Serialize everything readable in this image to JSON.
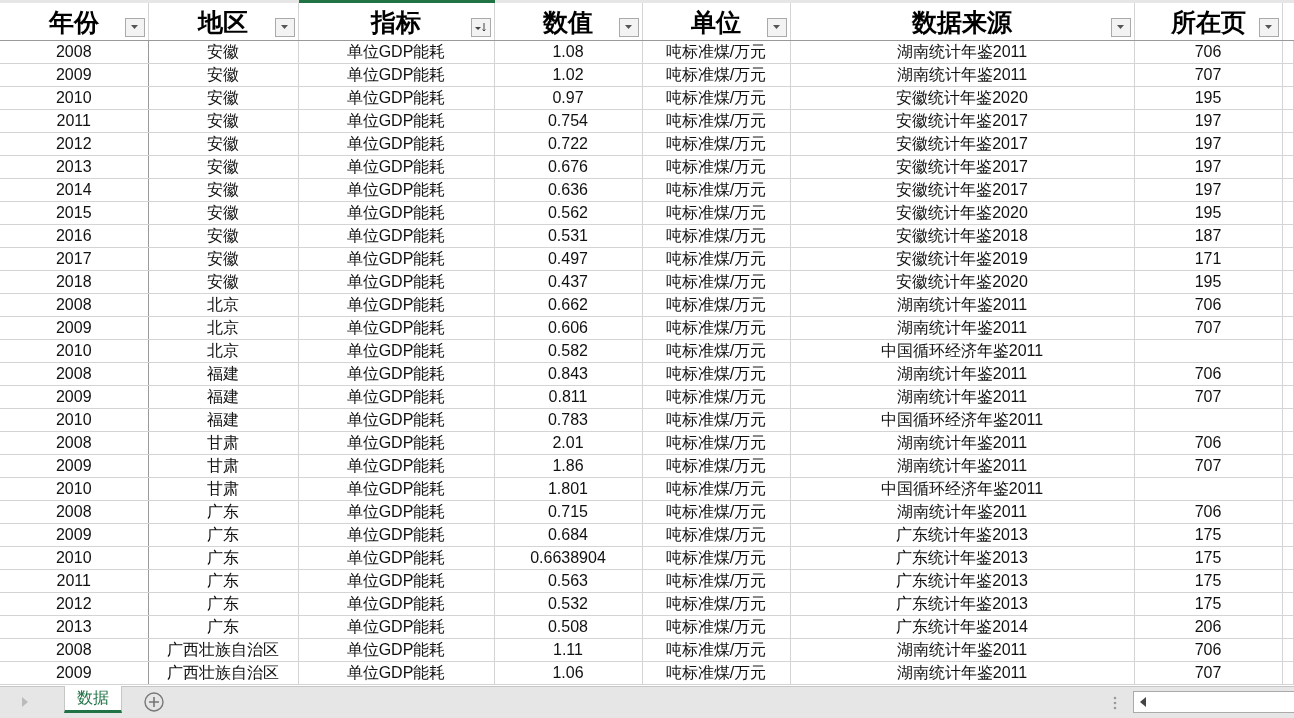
{
  "columns": [
    {
      "label": "年份",
      "sorted": false,
      "selected": false
    },
    {
      "label": "地区",
      "sorted": false,
      "selected": false
    },
    {
      "label": "指标",
      "sorted": true,
      "selected": true
    },
    {
      "label": "数值",
      "sorted": false,
      "selected": false
    },
    {
      "label": "单位",
      "sorted": false,
      "selected": false
    },
    {
      "label": "数据来源",
      "sorted": false,
      "selected": false
    },
    {
      "label": "所在页",
      "sorted": false,
      "selected": false
    }
  ],
  "rows": [
    {
      "year": "2008",
      "region": "安徽",
      "indicator": "单位GDP能耗",
      "value": "1.08",
      "unit": "吨标准煤/万元",
      "source": "湖南统计年鉴2011",
      "page": "706"
    },
    {
      "year": "2009",
      "region": "安徽",
      "indicator": "单位GDP能耗",
      "value": "1.02",
      "unit": "吨标准煤/万元",
      "source": "湖南统计年鉴2011",
      "page": "707"
    },
    {
      "year": "2010",
      "region": "安徽",
      "indicator": "单位GDP能耗",
      "value": "0.97",
      "unit": "吨标准煤/万元",
      "source": "安徽统计年鉴2020",
      "page": "195"
    },
    {
      "year": "2011",
      "region": "安徽",
      "indicator": "单位GDP能耗",
      "value": "0.754",
      "unit": "吨标准煤/万元",
      "source": "安徽统计年鉴2017",
      "page": "197"
    },
    {
      "year": "2012",
      "region": "安徽",
      "indicator": "单位GDP能耗",
      "value": "0.722",
      "unit": "吨标准煤/万元",
      "source": "安徽统计年鉴2017",
      "page": "197"
    },
    {
      "year": "2013",
      "region": "安徽",
      "indicator": "单位GDP能耗",
      "value": "0.676",
      "unit": "吨标准煤/万元",
      "source": "安徽统计年鉴2017",
      "page": "197"
    },
    {
      "year": "2014",
      "region": "安徽",
      "indicator": "单位GDP能耗",
      "value": "0.636",
      "unit": "吨标准煤/万元",
      "source": "安徽统计年鉴2017",
      "page": "197"
    },
    {
      "year": "2015",
      "region": "安徽",
      "indicator": "单位GDP能耗",
      "value": "0.562",
      "unit": "吨标准煤/万元",
      "source": "安徽统计年鉴2020",
      "page": "195"
    },
    {
      "year": "2016",
      "region": "安徽",
      "indicator": "单位GDP能耗",
      "value": "0.531",
      "unit": "吨标准煤/万元",
      "source": "安徽统计年鉴2018",
      "page": "187"
    },
    {
      "year": "2017",
      "region": "安徽",
      "indicator": "单位GDP能耗",
      "value": "0.497",
      "unit": "吨标准煤/万元",
      "source": "安徽统计年鉴2019",
      "page": "171"
    },
    {
      "year": "2018",
      "region": "安徽",
      "indicator": "单位GDP能耗",
      "value": "0.437",
      "unit": "吨标准煤/万元",
      "source": "安徽统计年鉴2020",
      "page": "195"
    },
    {
      "year": "2008",
      "region": "北京",
      "indicator": "单位GDP能耗",
      "value": "0.662",
      "unit": "吨标准煤/万元",
      "source": "湖南统计年鉴2011",
      "page": "706"
    },
    {
      "year": "2009",
      "region": "北京",
      "indicator": "单位GDP能耗",
      "value": "0.606",
      "unit": "吨标准煤/万元",
      "source": "湖南统计年鉴2011",
      "page": "707"
    },
    {
      "year": "2010",
      "region": "北京",
      "indicator": "单位GDP能耗",
      "value": "0.582",
      "unit": "吨标准煤/万元",
      "source": "中国循环经济年鉴2011"
    },
    {
      "year": "2008",
      "region": "福建",
      "indicator": "单位GDP能耗",
      "value": "0.843",
      "unit": "吨标准煤/万元",
      "source": "湖南统计年鉴2011",
      "page": "706"
    },
    {
      "year": "2009",
      "region": "福建",
      "indicator": "单位GDP能耗",
      "value": "0.811",
      "unit": "吨标准煤/万元",
      "source": "湖南统计年鉴2011",
      "page": "707"
    },
    {
      "year": "2010",
      "region": "福建",
      "indicator": "单位GDP能耗",
      "value": "0.783",
      "unit": "吨标准煤/万元",
      "source": "中国循环经济年鉴2011"
    },
    {
      "year": "2008",
      "region": "甘肃",
      "indicator": "单位GDP能耗",
      "value": "2.01",
      "unit": "吨标准煤/万元",
      "source": "湖南统计年鉴2011",
      "page": "706"
    },
    {
      "year": "2009",
      "region": "甘肃",
      "indicator": "单位GDP能耗",
      "value": "1.86",
      "unit": "吨标准煤/万元",
      "source": "湖南统计年鉴2011",
      "page": "707"
    },
    {
      "year": "2010",
      "region": "甘肃",
      "indicator": "单位GDP能耗",
      "value": "1.801",
      "unit": "吨标准煤/万元",
      "source": "中国循环经济年鉴2011"
    },
    {
      "year": "2008",
      "region": "广东",
      "indicator": "单位GDP能耗",
      "value": "0.715",
      "unit": "吨标准煤/万元",
      "source": "湖南统计年鉴2011",
      "page": "706"
    },
    {
      "year": "2009",
      "region": "广东",
      "indicator": "单位GDP能耗",
      "value": "0.684",
      "unit": "吨标准煤/万元",
      "source": "广东统计年鉴2013",
      "page": "175"
    },
    {
      "year": "2010",
      "region": "广东",
      "indicator": "单位GDP能耗",
      "value": "0.6638904",
      "unit": "吨标准煤/万元",
      "source": "广东统计年鉴2013",
      "page": "175"
    },
    {
      "year": "2011",
      "region": "广东",
      "indicator": "单位GDP能耗",
      "value": "0.563",
      "unit": "吨标准煤/万元",
      "source": "广东统计年鉴2013",
      "page": "175"
    },
    {
      "year": "2012",
      "region": "广东",
      "indicator": "单位GDP能耗",
      "value": "0.532",
      "unit": "吨标准煤/万元",
      "source": "广东统计年鉴2013",
      "page": "175"
    },
    {
      "year": "2013",
      "region": "广东",
      "indicator": "单位GDP能耗",
      "value": "0.508",
      "unit": "吨标准煤/万元",
      "source": "广东统计年鉴2014",
      "page": "206"
    },
    {
      "year": "2008",
      "region": "广西壮族自治区",
      "indicator": "单位GDP能耗",
      "value": "1.11",
      "unit": "吨标准煤/万元",
      "source": "湖南统计年鉴2011",
      "page": "706"
    },
    {
      "year": "2009",
      "region": "广西壮族自治区",
      "indicator": "单位GDP能耗",
      "value": "1.06",
      "unit": "吨标准煤/万元",
      "source": "湖南统计年鉴2011",
      "page": "707"
    }
  ],
  "sheet_tabs": [
    {
      "label": "数据",
      "selected": true
    }
  ]
}
